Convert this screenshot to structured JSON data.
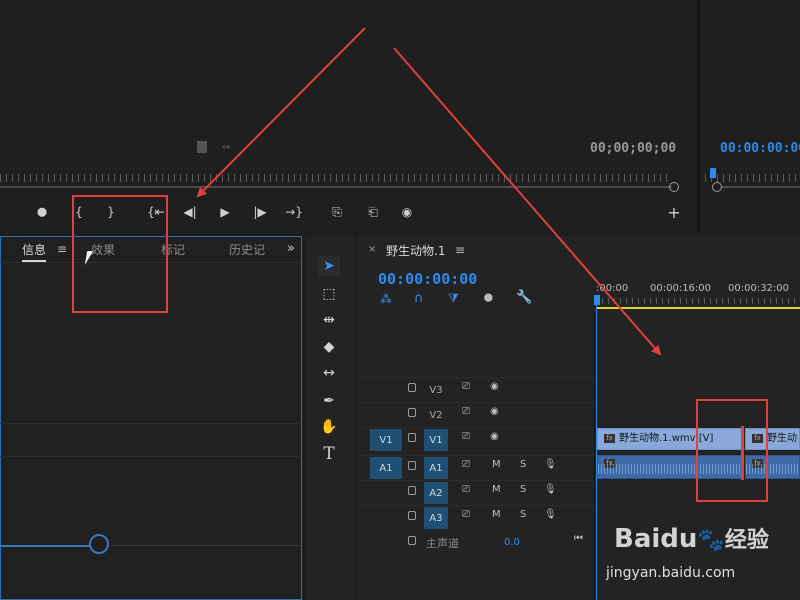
{
  "source_monitor": {
    "timecode": "00;00;00;00"
  },
  "program_monitor": {
    "timecode": "00:00:00:00"
  },
  "panel_tabs": [
    {
      "label": "信息",
      "active": true
    },
    {
      "label": "效果",
      "active": false
    },
    {
      "label": "标记",
      "active": false
    },
    {
      "label": "历史记",
      "active": false
    }
  ],
  "timeline": {
    "sequence_name": "野生动物.1",
    "timecode": "00:00:00:00",
    "ruler_labels": [
      ":00:00",
      "00:00:16:00",
      "00:00:32:00"
    ],
    "tracks_video": [
      {
        "name": "V3",
        "source": ""
      },
      {
        "name": "V2",
        "source": ""
      },
      {
        "name": "V1",
        "source": "V1"
      }
    ],
    "tracks_audio": [
      {
        "name": "A1",
        "source": "A1"
      },
      {
        "name": "A2",
        "source": ""
      },
      {
        "name": "A3",
        "source": ""
      }
    ],
    "master": {
      "label": "主声道",
      "value": "0.0"
    },
    "toggles": {
      "mute": "M",
      "solo": "S"
    },
    "video_clip_label": "野生动物.1.wmv [V]",
    "video_clip2_label": "野生动",
    "fx_label": "fx"
  },
  "tools": [
    "selection-tool",
    "track-select-tool",
    "ripple-edit-tool",
    "razor-tool",
    "slip-tool",
    "pen-tool",
    "hand-tool",
    "type-tool"
  ],
  "type_tool_glyph": "T",
  "watermark": {
    "brand": "Baidu",
    "brand_cn": "经验",
    "url": "jingyan.baidu.com"
  },
  "colors": {
    "accent_blue": "#2d8ceb",
    "annotation_red": "#e0413c",
    "playhead_yellow": "#e6d32a"
  }
}
